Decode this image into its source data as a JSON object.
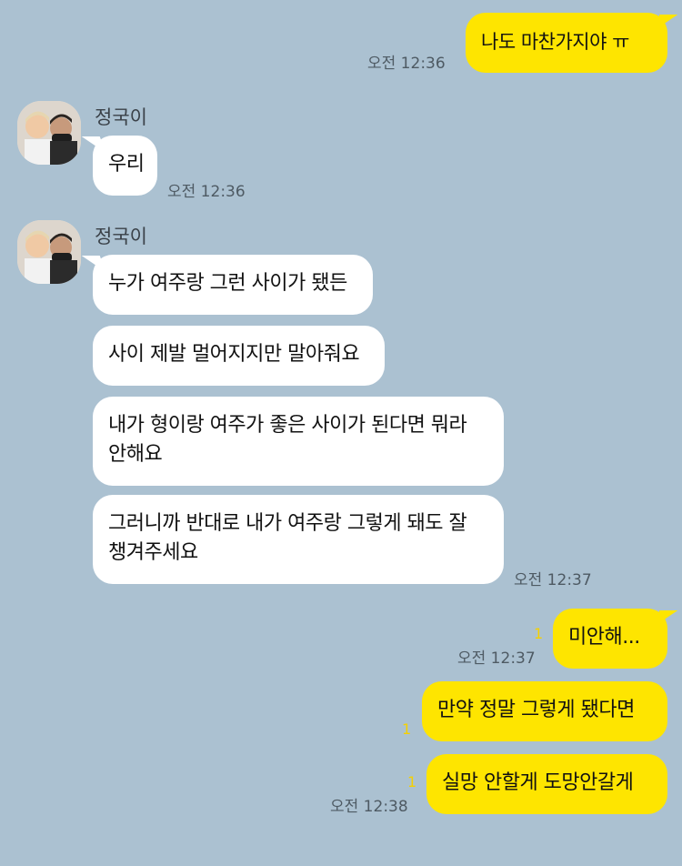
{
  "messages": {
    "m1": {
      "text": "나도 마찬가지야 ㅠ",
      "time": "오전 12:36"
    },
    "m2": {
      "sender": "정국이",
      "text": "우리",
      "time": "오전 12:36"
    },
    "m3": {
      "sender": "정국이",
      "text": "누가 여주랑 그런 사이가 됐든"
    },
    "m4": {
      "text": "사이 제발 멀어지지만 말아줘요"
    },
    "m5": {
      "text": "내가 형이랑 여주가 좋은 사이가 된다면 뭐라 안해요"
    },
    "m6": {
      "text": "그러니까 반대로 내가 여주랑 그렇게 돼도 잘 챙겨주세요",
      "time": "오전 12:37"
    },
    "m7": {
      "text": "미안해...",
      "unread": "1",
      "time": "오전 12:37"
    },
    "m8": {
      "text": "만약 정말 그렇게 됐다면",
      "unread": "1"
    },
    "m9": {
      "text": "실망 안할게 도망안갈게",
      "unread": "1",
      "time": "오전 12:38"
    }
  },
  "colors": {
    "background": "#abc1d1",
    "my_bubble": "#fee500",
    "their_bubble": "#ffffff",
    "unread": "#f5d100"
  },
  "icons": {
    "avatar": "profile-photo"
  }
}
